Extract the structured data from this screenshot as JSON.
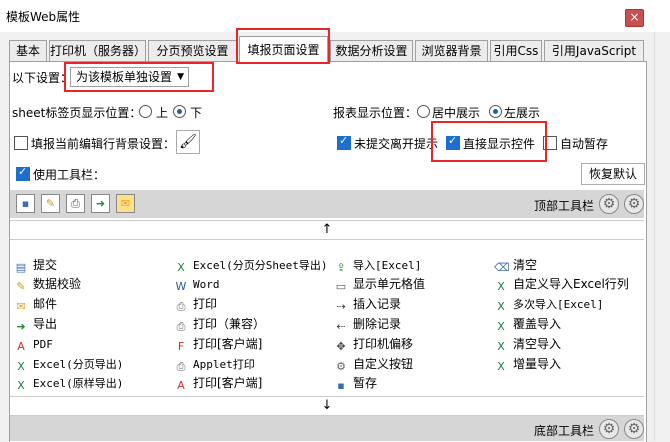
{
  "window": {
    "title": "模板Web属性",
    "close": "×"
  },
  "tabs": [
    {
      "label": "基本"
    },
    {
      "label": "打印机（服务器）"
    },
    {
      "label": "分页预览设置"
    },
    {
      "label": "填报页面设置"
    },
    {
      "label": "数据分析设置"
    },
    {
      "label": "浏览器背景"
    },
    {
      "label": "引用Css"
    },
    {
      "label": "引用JavaScript"
    }
  ],
  "active_tab": "填报页面设置",
  "settings": {
    "scope_label": "以下设置：",
    "scope_value": "为该模板单独设置",
    "sheet_tab_label": "sheet标签页显示位置：",
    "sheet_tab_options": [
      "上",
      "下"
    ],
    "sheet_tab_selected": "下",
    "report_pos_label": "报表显示位置：",
    "report_pos_options": [
      "居中展示",
      "左展示"
    ],
    "report_pos_selected": "左展示",
    "fill_row_bg_label": "填报当前编辑行背景设置：",
    "fill_row_bg_checked": false,
    "unsubmitted_label": "未提交离开提示",
    "unsubmitted_checked": true,
    "direct_control_label": "直接显示控件",
    "direct_control_checked": true,
    "autosave_label": "自动暂存",
    "autosave_checked": false,
    "use_toolbar_label": "使用工具栏：",
    "use_toolbar_checked": true,
    "restore_default_label": "恢复默认"
  },
  "toolbar": {
    "top_label": "顶部工具栏",
    "bottom_label": "底部工具栏",
    "up_arrow": "↑",
    "down_arrow": "↓",
    "icons": [
      "save-icon",
      "edit-icon",
      "print-icon",
      "export-icon",
      "mail-icon"
    ]
  },
  "buttons": [
    [
      {
        "label": "提交",
        "icon": "submit-icon",
        "color": "#3a6db5"
      },
      {
        "label": "Excel(分页分Sheet导出)",
        "icon": "excel-icon",
        "color": "#1e7b45",
        "mono": true
      },
      {
        "label": "导入[Excel]",
        "icon": "import-icon",
        "color": "#2a8a3a",
        "mono": true
      },
      {
        "label": "清空",
        "icon": "clear-icon",
        "color": "#3a6db5"
      }
    ],
    [
      {
        "label": "数据校验",
        "icon": "verify-icon",
        "color": "#c99a1a"
      },
      {
        "label": "Word",
        "icon": "word-icon",
        "color": "#2b579a",
        "mono": true
      },
      {
        "label": "显示单元格值",
        "icon": "cell-icon",
        "color": "#555555"
      },
      {
        "label": "自定义导入Excel行列",
        "icon": "excel-icon",
        "color": "#1e7b45"
      }
    ],
    [
      {
        "label": "邮件",
        "icon": "mail-icon",
        "color": "#e0a020"
      },
      {
        "label": "打印",
        "icon": "print-icon",
        "color": "#666666"
      },
      {
        "label": "插入记录",
        "icon": "insert-row-icon",
        "color": "#444444"
      },
      {
        "label": "多次导入[Excel]",
        "icon": "excel-icon",
        "color": "#1e7b45",
        "mono": true
      }
    ],
    [
      {
        "label": "导出",
        "icon": "export-icon",
        "color": "#2a8a3a"
      },
      {
        "label": "打印（兼容）",
        "icon": "print-icon",
        "color": "#666666"
      },
      {
        "label": "删除记录",
        "icon": "delete-row-icon",
        "color": "#444444"
      },
      {
        "label": "覆盖导入",
        "icon": "excel-icon",
        "color": "#1e7b45"
      }
    ],
    [
      {
        "label": "PDF",
        "icon": "pdf-icon",
        "color": "#d0312d",
        "mono": true
      },
      {
        "label": "打印[客户端]",
        "icon": "flash-print-icon",
        "color": "#d0312d"
      },
      {
        "label": "打印机偏移",
        "icon": "move-icon",
        "color": "#444444"
      },
      {
        "label": "清空导入",
        "icon": "excel-icon",
        "color": "#1e7b45"
      }
    ],
    [
      {
        "label": "Excel(分页导出)",
        "icon": "excel-icon",
        "color": "#1e7b45",
        "mono": true
      },
      {
        "label": "Applet打印",
        "icon": "applet-print-icon",
        "color": "#666666",
        "mono": true
      },
      {
        "label": "自定义按钮",
        "icon": "gear-icon",
        "color": "#666666"
      },
      {
        "label": "增量导入",
        "icon": "excel-icon",
        "color": "#1e7b45"
      }
    ],
    [
      {
        "label": "Excel(原样导出)",
        "icon": "excel-icon",
        "color": "#1e7b45",
        "mono": true
      },
      {
        "label": "打印[客户端]",
        "icon": "pdf-print-icon",
        "color": "#d0312d"
      },
      {
        "label": "暂存",
        "icon": "save-icon",
        "color": "#3a6db5"
      },
      {
        "label": "",
        "icon": "",
        "color": ""
      }
    ]
  ]
}
